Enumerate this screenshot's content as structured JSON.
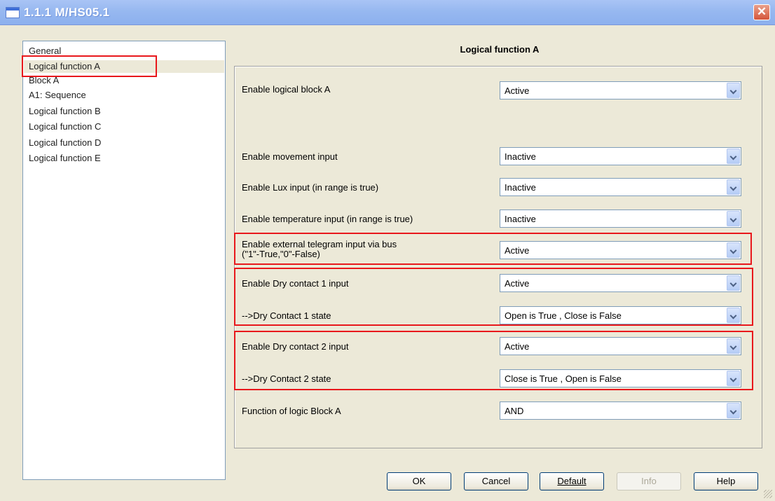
{
  "window": {
    "title": "1.1.1 M/HS05.1",
    "close_glyph": "✕"
  },
  "tree": {
    "items": [
      "General",
      "Logical function A",
      "Block A",
      "A1: Sequence",
      "Logical function B",
      "Logical function C",
      "Logical function D",
      "Logical function E"
    ],
    "selected": "Logical function A"
  },
  "panel": {
    "header": "Logical function A",
    "rows": [
      {
        "label": "Enable logical block A",
        "value": "Active"
      },
      {
        "label": "Enable movement input",
        "value": "Inactive"
      },
      {
        "label": "Enable Lux input (in range is true)",
        "value": "Inactive"
      },
      {
        "label": "Enable temperature input (in range is true)",
        "value": "Inactive"
      },
      {
        "label_line1": "Enable external telegram input via bus",
        "label_line2": "(\"1\"-True,\"0\"-False)",
        "value": "Active"
      },
      {
        "label": "Enable Dry contact 1 input",
        "value": "Active"
      },
      {
        "label": "-->Dry Contact 1 state",
        "value": "Open is True , Close is False"
      },
      {
        "label": "Enable Dry contact 2 input",
        "value": "Active"
      },
      {
        "label": "-->Dry Contact 2 state",
        "value": "Close is True , Open is False"
      },
      {
        "label": "Function of logic Block A",
        "value": "AND"
      }
    ]
  },
  "buttons": {
    "ok": "OK",
    "cancel": "Cancel",
    "default": "Default",
    "info": "Info",
    "help": "Help"
  },
  "colors": {
    "highlight": "#e8181c",
    "titlebar": "#97b8f0"
  }
}
